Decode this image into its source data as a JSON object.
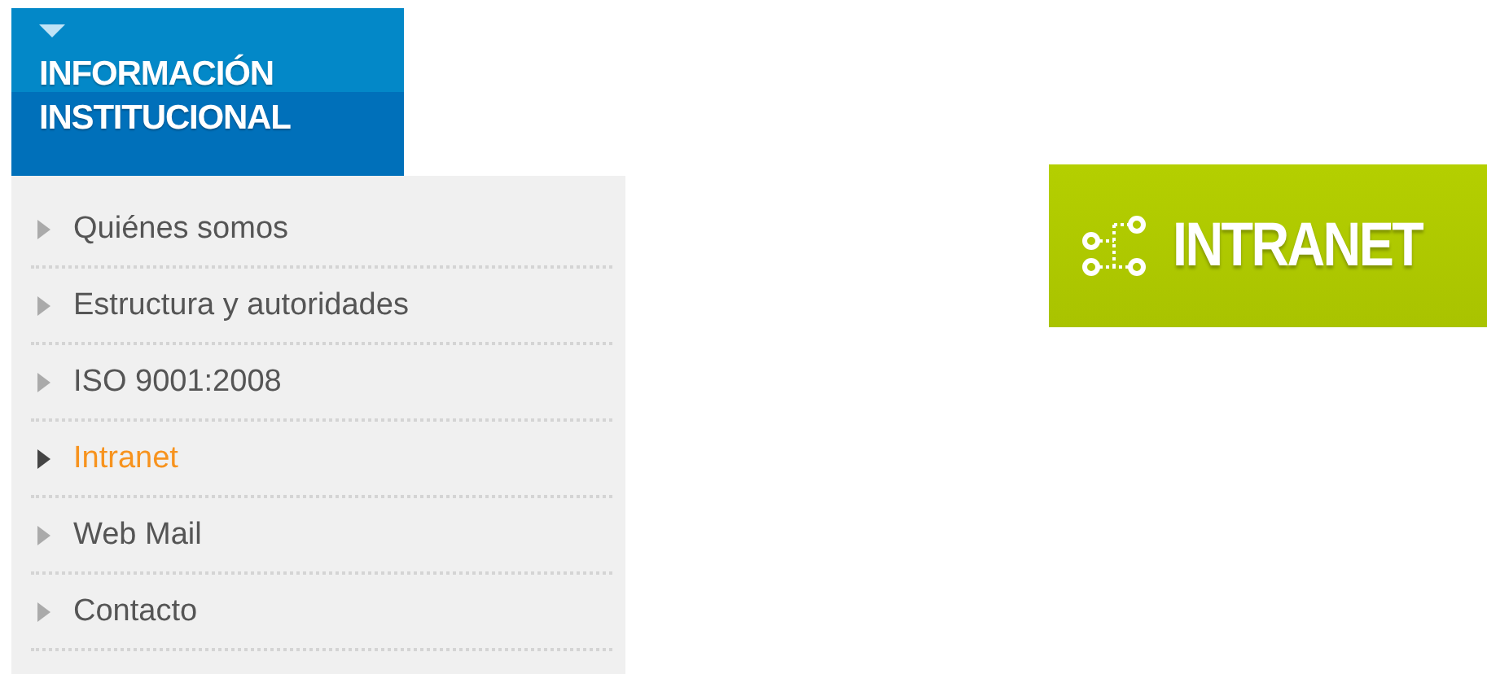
{
  "sidebar": {
    "title_lines": [
      "INFORMACIÓN",
      "INSTITUCIONAL"
    ],
    "expanded": true,
    "items": [
      {
        "label": "Quiénes somos",
        "selected": false
      },
      {
        "label": "Estructura y autoridades",
        "selected": false
      },
      {
        "label": "ISO 9001:2008",
        "selected": false
      },
      {
        "label": "Intranet",
        "selected": true
      },
      {
        "label": "Web Mail",
        "selected": false
      },
      {
        "label": "Contacto",
        "selected": false
      }
    ]
  },
  "banner": {
    "label": "INTRANET"
  }
}
